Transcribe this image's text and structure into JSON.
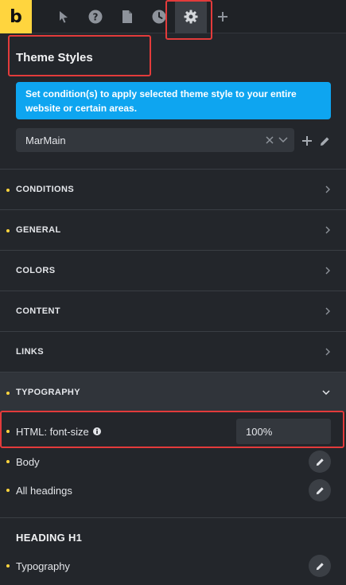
{
  "toolbar": {
    "logo": "b",
    "icons": [
      "cursor-icon",
      "help-icon",
      "page-icon",
      "history-icon",
      "gear-icon",
      "plus-icon"
    ]
  },
  "panel": {
    "title": "Theme Styles",
    "info": "Set condition(s) to apply selected theme style to your entire website or certain areas.",
    "selected_style": "MarMain"
  },
  "sections": [
    {
      "label": "CONDITIONS",
      "marked": true
    },
    {
      "label": "GENERAL",
      "marked": true
    },
    {
      "label": "COLORS",
      "marked": false
    },
    {
      "label": "CONTENT",
      "marked": false
    },
    {
      "label": "LINKS",
      "marked": false
    },
    {
      "label": "TYPOGRAPHY",
      "marked": true,
      "open": true
    }
  ],
  "typography": {
    "html_font_size_label": "HTML: font-size",
    "html_font_size_value": "100%",
    "body_label": "Body",
    "all_headings_label": "All headings"
  },
  "heading_h1": {
    "title": "HEADING H1",
    "typography_label": "Typography"
  },
  "colors": {
    "accent": "#ffd53e",
    "info": "#0ea5f0",
    "highlight": "#e33b3b",
    "background": "#23262b"
  }
}
